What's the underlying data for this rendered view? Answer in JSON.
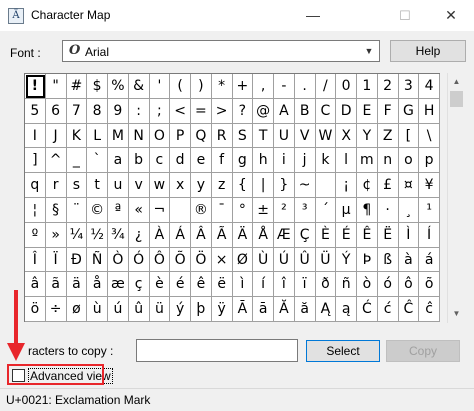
{
  "window": {
    "title": "Character Map",
    "minimize": "—",
    "maximize": "☐",
    "close": "✕",
    "icon": "character-map-app-icon"
  },
  "font": {
    "label": "Font :",
    "selected": "Arial",
    "icon": "opentype-font-icon"
  },
  "buttons": {
    "help": "Help",
    "select": "Select",
    "copy": "Copy"
  },
  "characters_to_copy": {
    "label": "racters to copy :",
    "value": ""
  },
  "advanced_view": {
    "label": "Advanced view",
    "checked": false
  },
  "status": "U+0021: Exclamation Mark",
  "selected_index": 0,
  "annotation_color": "#e8262b",
  "grid": [
    [
      "!",
      "\"",
      "#",
      "$",
      "%",
      "&",
      "'",
      "(",
      ")",
      "*",
      "+",
      ",",
      "-",
      ".",
      "/",
      "0",
      "1",
      "2",
      "3",
      "4"
    ],
    [
      "5",
      "6",
      "7",
      "8",
      "9",
      ":",
      ";",
      "<",
      "=",
      ">",
      "?",
      "@",
      "A",
      "B",
      "C",
      "D",
      "E",
      "F",
      "G",
      "H"
    ],
    [
      "I",
      "J",
      "K",
      "L",
      "M",
      "N",
      "O",
      "P",
      "Q",
      "R",
      "S",
      "T",
      "U",
      "V",
      "W",
      "X",
      "Y",
      "Z",
      "[",
      "\\"
    ],
    [
      "]",
      "^",
      "_",
      "`",
      "a",
      "b",
      "c",
      "d",
      "e",
      "f",
      "g",
      "h",
      "i",
      "j",
      "k",
      "l",
      "m",
      "n",
      "o",
      "p"
    ],
    [
      "q",
      "r",
      "s",
      "t",
      "u",
      "v",
      "w",
      "x",
      "y",
      "z",
      "{",
      "|",
      "}",
      "~",
      " ",
      "¡",
      "¢",
      "£",
      "¤",
      "¥"
    ],
    [
      "¦",
      "§",
      "¨",
      "©",
      "ª",
      "«",
      "¬",
      "­",
      "®",
      "¯",
      "°",
      "±",
      "²",
      "³",
      "´",
      "µ",
      "¶",
      "·",
      "¸",
      "¹"
    ],
    [
      "º",
      "»",
      "¼",
      "½",
      "¾",
      "¿",
      "À",
      "Á",
      "Â",
      "Ã",
      "Ä",
      "Å",
      "Æ",
      "Ç",
      "È",
      "É",
      "Ê",
      "Ë",
      "Ì",
      "Í"
    ],
    [
      "Î",
      "Ï",
      "Ð",
      "Ñ",
      "Ò",
      "Ó",
      "Ô",
      "Õ",
      "Ö",
      "×",
      "Ø",
      "Ù",
      "Ú",
      "Û",
      "Ü",
      "Ý",
      "Þ",
      "ß",
      "à",
      "á"
    ],
    [
      "â",
      "ã",
      "ä",
      "å",
      "æ",
      "ç",
      "è",
      "é",
      "ê",
      "ë",
      "ì",
      "í",
      "î",
      "ï",
      "ð",
      "ñ",
      "ò",
      "ó",
      "ô",
      "õ"
    ],
    [
      "ö",
      "÷",
      "ø",
      "ù",
      "ú",
      "û",
      "ü",
      "ý",
      "þ",
      "ÿ",
      "Ā",
      "ā",
      "Ă",
      "ă",
      "Ą",
      "ą",
      "Ć",
      "ć",
      "Ĉ",
      "ĉ"
    ]
  ]
}
